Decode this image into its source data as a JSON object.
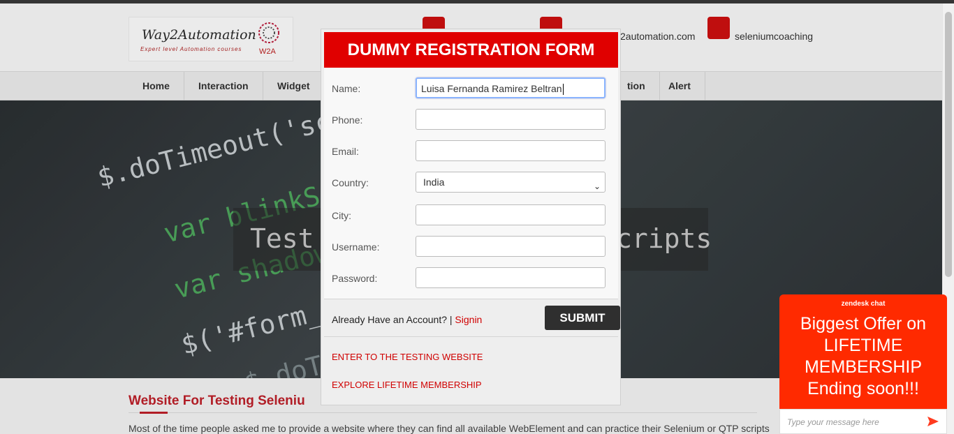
{
  "site": {
    "logo_title": "Way2Automation",
    "logo_tagline": "Expert level Automation courses",
    "logo_mark": "W2A",
    "contacts": [
      {
        "icon": "phone-icon",
        "text": ""
      },
      {
        "icon": "email-icon",
        "text": "2automation.com"
      },
      {
        "icon": "skype-icon",
        "text": "seleniumcoaching"
      }
    ],
    "nav": [
      "Home",
      "Interaction",
      "Widget",
      "tion",
      "Alert"
    ],
    "hero_text_left": "Test",
    "hero_text_right": "cripts",
    "code_lines": [
      "$.doTimeout('scr",
      "var blinkSpe",
      "var shadowT",
      "$('#form_s",
      "$.doTi"
    ],
    "section_title": "Website For Testing Seleniu",
    "section_body": "Most of the time people asked me to provide a website where they can find all available WebElement and can practice their Selenium or QTP scripts"
  },
  "modal": {
    "title": "DUMMY REGISTRATION FORM",
    "labels": {
      "name": "Name:",
      "phone": "Phone:",
      "email": "Email:",
      "country": "Country:",
      "city": "City:",
      "username": "Username:",
      "password": "Password:"
    },
    "values": {
      "name": "Luisa Fernanda Ramirez Beltran",
      "phone": "",
      "email": "",
      "country": "India",
      "city": "",
      "username": "",
      "password": ""
    },
    "account_text": "Already Have an Account? |",
    "signin_label": "Signin",
    "submit_label": "SUBMIT",
    "link_enter": "ENTER TO THE TESTING WEBSITE",
    "link_membership": "EXPLORE LIFETIME MEMBERSHIP"
  },
  "zendesk": {
    "brand": "zendesk chat",
    "message": "Biggest Offer on LIFETIME MEMBERSHIP Ending soon!!!",
    "placeholder": "Type your message here",
    "send_icon": "send-icon"
  },
  "colors": {
    "accent_red": "#e00000",
    "submit_dark": "#2f2f2f",
    "zendesk_red": "#ff2a00"
  }
}
